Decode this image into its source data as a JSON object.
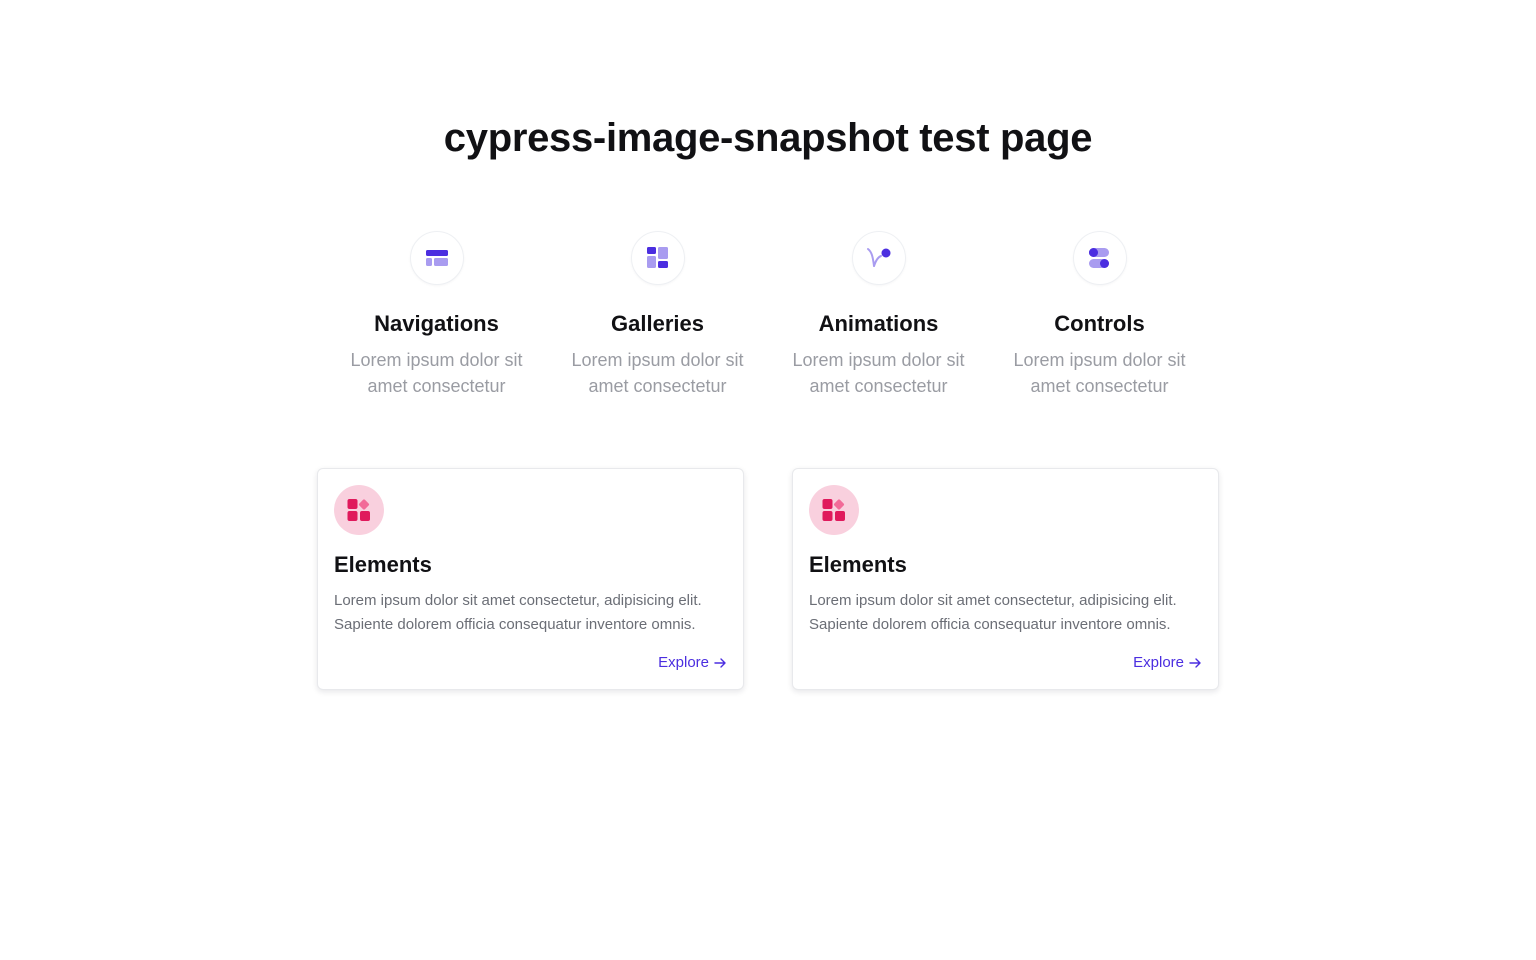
{
  "page": {
    "title": "cypress-image-snapshot test page"
  },
  "colors": {
    "accent": "#4b2ee0",
    "accent_light": "#a99cf0",
    "pink": "#e0195c",
    "pink_light": "#f26a98",
    "pink_bg": "#f9d0de"
  },
  "features": [
    {
      "title": "Navigations",
      "description": "Lorem ipsum dolor sit amet consectetur",
      "icon": "navigation-icon"
    },
    {
      "title": "Galleries",
      "description": "Lorem ipsum dolor sit amet consectetur",
      "icon": "gallery-icon"
    },
    {
      "title": "Animations",
      "description": "Lorem ipsum dolor sit amet consectetur",
      "icon": "animation-icon"
    },
    {
      "title": "Controls",
      "description": "Lorem ipsum dolor sit amet consectetur",
      "icon": "controls-icon"
    }
  ],
  "cards": [
    {
      "title": "Elements",
      "description": "Lorem ipsum dolor sit amet consectetur, adipisicing elit. Sapiente dolorem officia consequatur inventore omnis.",
      "link_label": "Explore",
      "icon": "elements-icon"
    },
    {
      "title": "Elements",
      "description": "Lorem ipsum dolor sit amet consectetur, adipisicing elit. Sapiente dolorem officia consequatur inventore omnis.",
      "link_label": "Explore",
      "icon": "elements-icon"
    }
  ]
}
